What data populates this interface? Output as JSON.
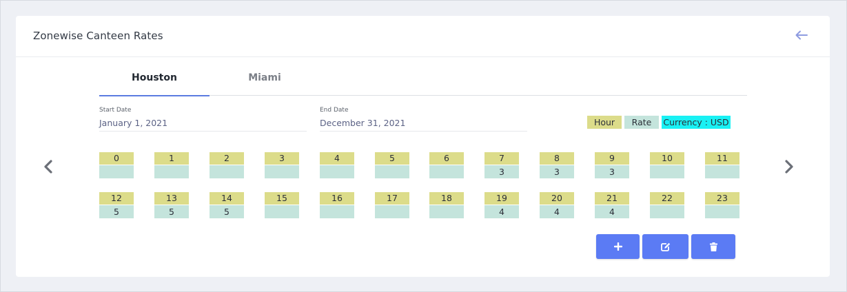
{
  "header": {
    "title": "Zonewise Canteen Rates",
    "back_icon": "arrow-left-icon"
  },
  "tabs": [
    {
      "label": "Houston",
      "active": true
    },
    {
      "label": "Miami",
      "active": false
    }
  ],
  "dates": {
    "start_label": "Start Date",
    "start_value": "January 1, 2021",
    "end_label": "End Date",
    "end_value": "December 31, 2021"
  },
  "legend": {
    "hour": "Hour",
    "rate": "Rate",
    "currency": "Currency : USD"
  },
  "hours": [
    {
      "hour": "0",
      "rate": ""
    },
    {
      "hour": "1",
      "rate": ""
    },
    {
      "hour": "2",
      "rate": ""
    },
    {
      "hour": "3",
      "rate": ""
    },
    {
      "hour": "4",
      "rate": ""
    },
    {
      "hour": "5",
      "rate": ""
    },
    {
      "hour": "6",
      "rate": ""
    },
    {
      "hour": "7",
      "rate": "3"
    },
    {
      "hour": "8",
      "rate": "3"
    },
    {
      "hour": "9",
      "rate": "3"
    },
    {
      "hour": "10",
      "rate": ""
    },
    {
      "hour": "11",
      "rate": ""
    },
    {
      "hour": "12",
      "rate": "5"
    },
    {
      "hour": "13",
      "rate": "5"
    },
    {
      "hour": "14",
      "rate": "5"
    },
    {
      "hour": "15",
      "rate": ""
    },
    {
      "hour": "16",
      "rate": ""
    },
    {
      "hour": "17",
      "rate": ""
    },
    {
      "hour": "18",
      "rate": ""
    },
    {
      "hour": "19",
      "rate": "4"
    },
    {
      "hour": "20",
      "rate": "4"
    },
    {
      "hour": "21",
      "rate": "4"
    },
    {
      "hour": "22",
      "rate": ""
    },
    {
      "hour": "23",
      "rate": ""
    }
  ],
  "actions": {
    "add_icon": "plus-icon",
    "edit_icon": "edit-icon",
    "delete_icon": "trash-icon"
  },
  "colors": {
    "accent": "#5b7bf4",
    "hour_bg": "#dcdc8a",
    "rate_bg": "#c4e4dc",
    "currency_bg": "#19f1f4"
  }
}
